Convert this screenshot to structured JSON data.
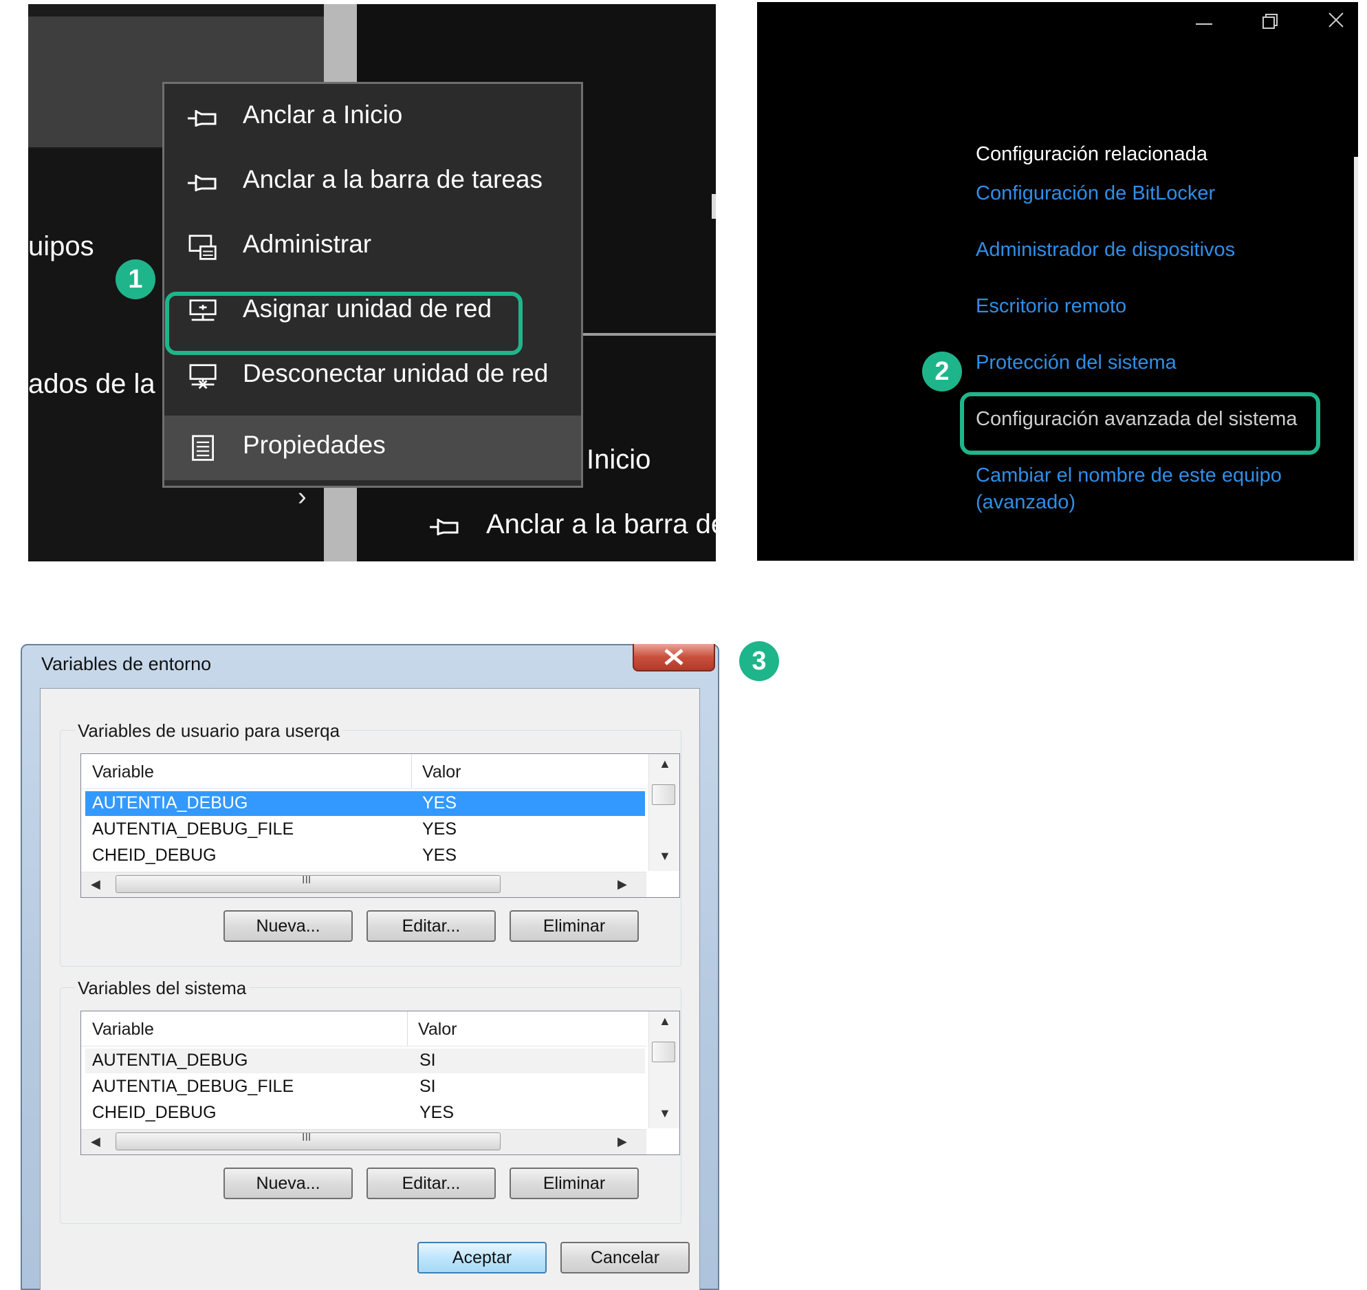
{
  "panel1": {
    "background_texts": {
      "left_top": "uipos",
      "left_bottom": "ados de la",
      "right_inicio": "Inicio",
      "right_pin": "Anclar a la barra de"
    },
    "menu": {
      "items": [
        {
          "label": "Anclar a Inicio",
          "icon": "pin-icon"
        },
        {
          "label": "Anclar a la barra de tareas",
          "icon": "pin-icon"
        },
        {
          "label": "Administrar",
          "icon": "computer-management-icon"
        },
        {
          "label": "Asignar unidad de red",
          "icon": "map-network-drive-icon"
        },
        {
          "label": "Desconectar unidad de red",
          "icon": "disconnect-network-drive-icon"
        },
        {
          "label": "Propiedades",
          "icon": "properties-icon"
        }
      ]
    },
    "badge": "1"
  },
  "panel2": {
    "title": "Configuración relacionada",
    "links": [
      "Configuración de BitLocker",
      "Administrador de dispositivos",
      "Escritorio remoto",
      "Protección del sistema",
      "Configuración avanzada del sistema",
      "Cambiar el nombre de este equipo",
      "(avanzado)"
    ],
    "badge": "2"
  },
  "panel3": {
    "title": "Variables de entorno",
    "badge": "3",
    "user_group": {
      "label": "Variables de usuario para userqa",
      "columns": [
        "Variable",
        "Valor"
      ],
      "rows": [
        {
          "variable": "AUTENTIA_DEBUG",
          "valor": "YES"
        },
        {
          "variable": "AUTENTIA_DEBUG_FILE",
          "valor": "YES"
        },
        {
          "variable": "CHEID_DEBUG",
          "valor": "YES"
        }
      ],
      "buttons": [
        "Nueva...",
        "Editar...",
        "Eliminar"
      ]
    },
    "system_group": {
      "label": "Variables del sistema",
      "columns": [
        "Variable",
        "Valor"
      ],
      "rows": [
        {
          "variable": "AUTENTIA_DEBUG",
          "valor": "SI"
        },
        {
          "variable": "AUTENTIA_DEBUG_FILE",
          "valor": "SI"
        },
        {
          "variable": "CHEID_DEBUG",
          "valor": "YES"
        }
      ],
      "buttons": [
        "Nueva...",
        "Editar...",
        "Eliminar"
      ]
    },
    "footer_buttons": [
      "Aceptar",
      "Cancelar"
    ],
    "scroll_grip": "III"
  },
  "colors": {
    "highlight_green": "#1fb58a",
    "link_blue": "#2f8fe8",
    "selection_blue": "#3399ff"
  }
}
